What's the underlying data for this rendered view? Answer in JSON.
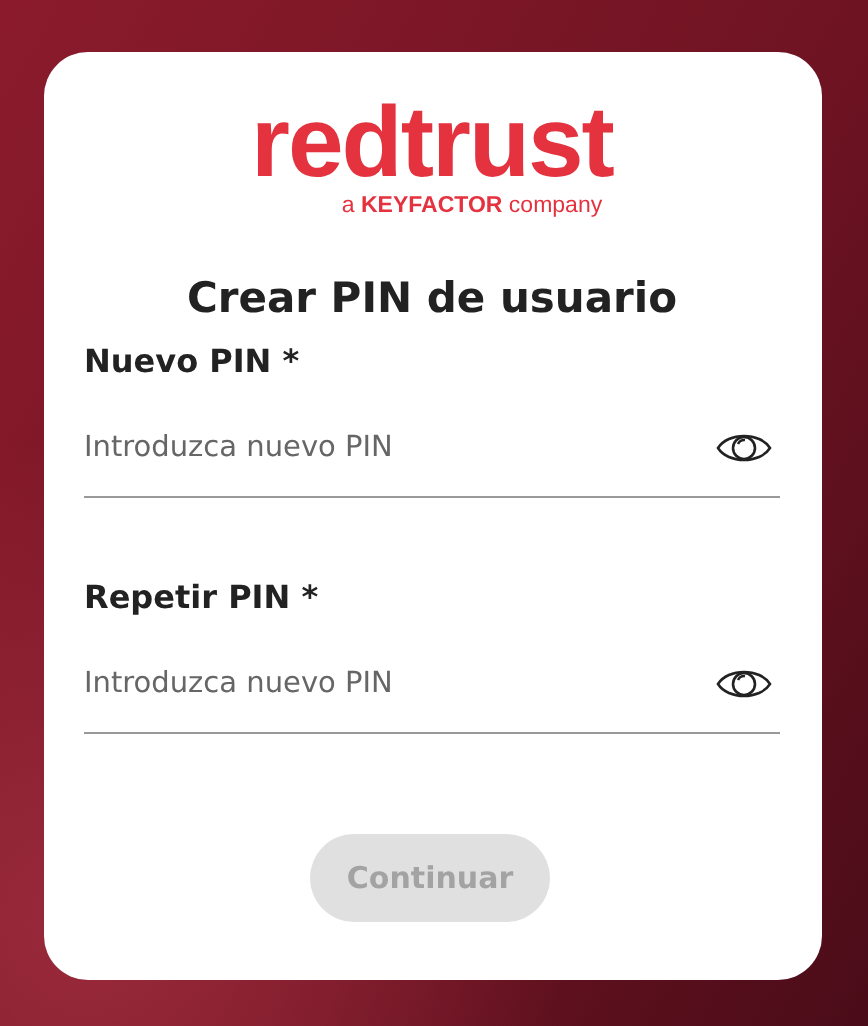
{
  "logo": {
    "brand": "redtrust",
    "tagline_prefix": "a",
    "tagline_company": "KEYFACTOR",
    "tagline_suffix": "company"
  },
  "title": "Crear PIN de usuario",
  "fields": [
    {
      "label": "Nuevo PIN *",
      "placeholder": "Introduzca nuevo PIN"
    },
    {
      "label": "Repetir PIN *",
      "placeholder": "Introduzca nuevo PIN"
    }
  ],
  "button": {
    "label": "Continuar",
    "disabled": true
  }
}
